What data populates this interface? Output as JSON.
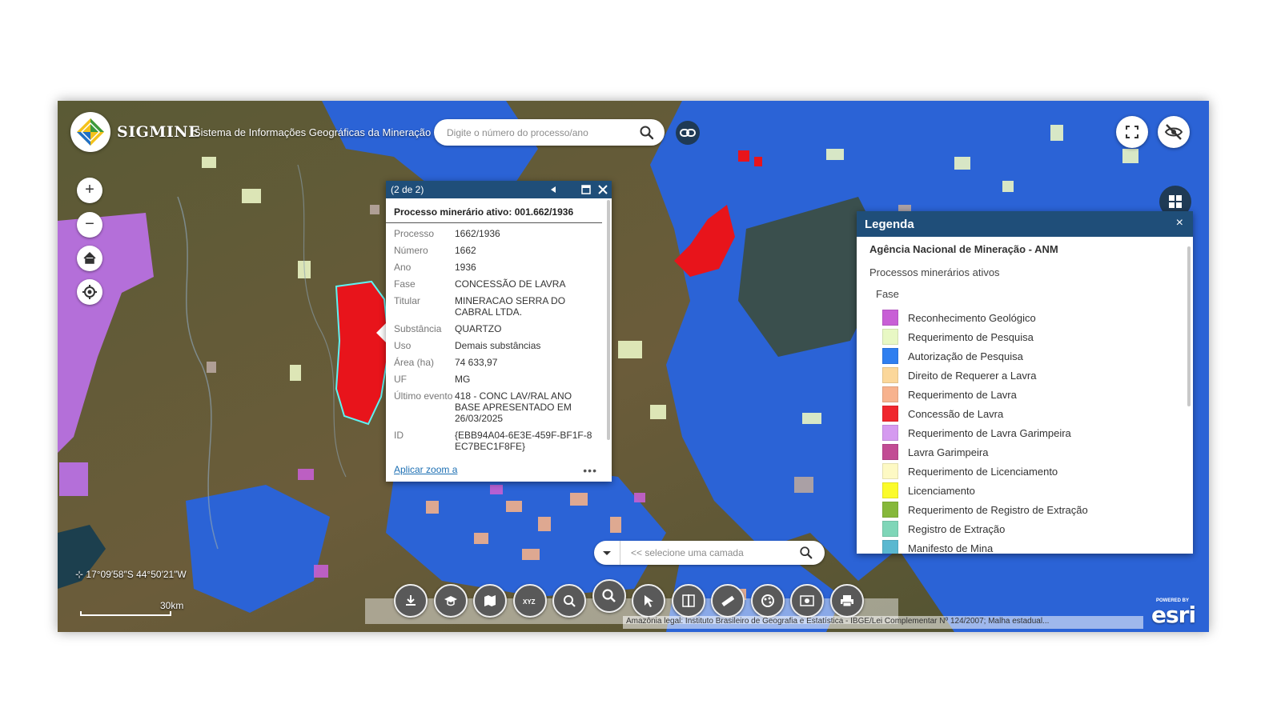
{
  "header": {
    "title": "SIGMINE",
    "subtitle": "Sistema de Informações Geográficas da Mineração",
    "search_placeholder": "Digite o número do processo/ano",
    "logo_icon": "anm-diamond-logo",
    "search_icon": "search-icon",
    "link_icon": "link-icon"
  },
  "top_right_controls": [
    {
      "icon": "fullscreen-icon"
    },
    {
      "icon": "eye-slash-icon"
    }
  ],
  "map_controls": [
    {
      "icon": "zoom-in-icon",
      "glyph": "+"
    },
    {
      "icon": "zoom-out-icon",
      "glyph": "−"
    },
    {
      "icon": "home-icon"
    },
    {
      "icon": "locate-icon"
    }
  ],
  "popup": {
    "count": "(2 de 2)",
    "title": "Processo minerário ativo: 001.662/1936",
    "fields": [
      {
        "key": "Processo",
        "value": "1662/1936"
      },
      {
        "key": "Número",
        "value": "1662"
      },
      {
        "key": "Ano",
        "value": "1936"
      },
      {
        "key": "Fase",
        "value": "CONCESSÃO DE LAVRA"
      },
      {
        "key": "Titular",
        "value": "MINERACAO SERRA DO CABRAL LTDA."
      },
      {
        "key": "Substância",
        "value": "QUARTZO"
      },
      {
        "key": "Uso",
        "value": "Demais substâncias"
      },
      {
        "key": "Área (ha)",
        "value": "74 633,97"
      },
      {
        "key": "UF",
        "value": "MG"
      },
      {
        "key": "Último evento",
        "value": "418 - CONC LAV/RAL ANO BASE APRESENTADO EM 26/03/2025"
      },
      {
        "key": "ID",
        "value": "{EBB94A04-6E3E-459F-BF1F-8EC7BEC1F8FE}"
      }
    ],
    "zoom_link": "Aplicar zoom a",
    "more": "•••"
  },
  "legend": {
    "title": "Legenda",
    "close": "×",
    "agency": "Agência Nacional de Mineração - ANM",
    "layer": "Processos minerários ativos",
    "field": "Fase",
    "items": [
      {
        "label": "Reconhecimento Geológico",
        "color": "#c85fd6"
      },
      {
        "label": "Requerimento de Pesquisa",
        "color": "#e8f8c4"
      },
      {
        "label": "Autorização de Pesquisa",
        "color": "#2f7ff0"
      },
      {
        "label": "Direito de Requerer a Lavra",
        "color": "#fbd79a"
      },
      {
        "label": "Requerimento de Lavra",
        "color": "#f7b28e"
      },
      {
        "label": "Concessão de Lavra",
        "color": "#f0262e"
      },
      {
        "label": "Requerimento de Lavra Garimpeira",
        "color": "#d59af0"
      },
      {
        "label": "Lavra Garimpeira",
        "color": "#c24c94"
      },
      {
        "label": "Requerimento de Licenciamento",
        "color": "#fdf9c4"
      },
      {
        "label": "Licenciamento",
        "color": "#fbfb2a"
      },
      {
        "label": "Requerimento de Registro de Extração",
        "color": "#86b83a"
      },
      {
        "label": "Registro de Extração",
        "color": "#7fd6b8"
      },
      {
        "label": "Manifesto de Mina",
        "color": "#5ab8d0"
      }
    ]
  },
  "layer_selector": {
    "placeholder": "<< selecione uma camada",
    "dropdown_icon": "caret-down-icon",
    "search_icon": "search-icon"
  },
  "toolbar": [
    {
      "icon": "download-icon"
    },
    {
      "icon": "graduation-cap-icon"
    },
    {
      "icon": "map-bookmark-icon"
    },
    {
      "icon": "xyz-icon",
      "text": "XYZ"
    },
    {
      "icon": "map-search-icon"
    },
    {
      "icon": "search-icon"
    },
    {
      "icon": "select-icon"
    },
    {
      "icon": "swipe-icon"
    },
    {
      "icon": "measure-icon"
    },
    {
      "icon": "layers-icon"
    },
    {
      "icon": "map-compare-icon"
    },
    {
      "icon": "print-icon"
    }
  ],
  "footer": {
    "coordinates": "17°09′58″S 44°50′21″W",
    "scale": "30km",
    "attribution": "Amazônia legal: Instituto Brasileiro de Geografia e Estatística - IBGE/Lei Complementar Nº 124/2007; Malha estadual...",
    "powered_by": "POWERED BY",
    "esri": "esri"
  },
  "colors": {
    "header_blue": "#1f4e79",
    "concession_red": "#f0262e",
    "research_blue": "#2f7ff0",
    "terrain_green": "#5c5a33"
  }
}
